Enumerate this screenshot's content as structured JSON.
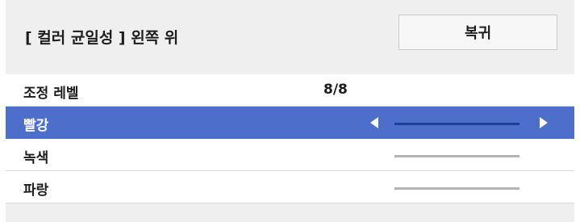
{
  "header": {
    "title": "[ 컬러 균일성 ] 왼쪽 위",
    "reset_label": "복귀"
  },
  "rows": [
    {
      "label": "조정 레벨",
      "value": "8/8"
    },
    {
      "label": "빨강",
      "selected": true,
      "level": 1.0
    },
    {
      "label": "녹색",
      "level": 1.0
    },
    {
      "label": "파랑",
      "level": 1.0
    }
  ],
  "colors": {
    "selection": "#4d6fcb",
    "slider_selected": "#1f3f96",
    "slider_normal": "#b4b4b4",
    "background": "#efefef"
  }
}
